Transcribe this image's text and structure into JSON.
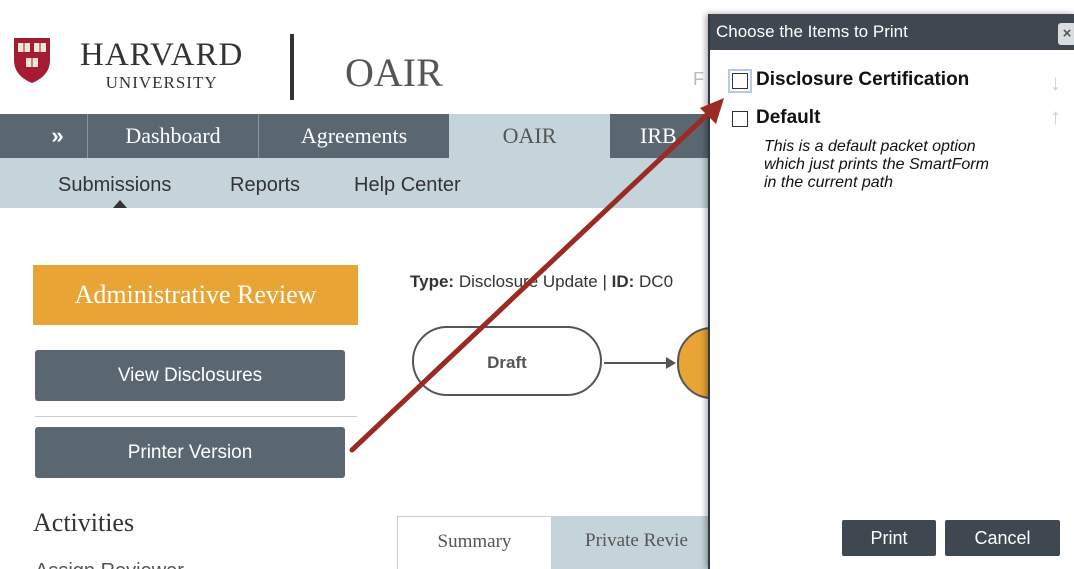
{
  "header": {
    "logo_line1": "HARVARD",
    "logo_line2": "UNIVERSITY",
    "site_title": "OAIR",
    "ghost_char": "F"
  },
  "nav": {
    "toggle": "»",
    "items": [
      {
        "label": "Dashboard"
      },
      {
        "label": "Agreements"
      },
      {
        "label": "OAIR"
      },
      {
        "label": "IRB"
      }
    ]
  },
  "subnav": {
    "items": [
      {
        "label": "Submissions"
      },
      {
        "label": "Reports"
      },
      {
        "label": "Help Center"
      }
    ]
  },
  "sidebar": {
    "state": "Administrative Review",
    "view_disclosures": "View Disclosures",
    "printer_version": "Printer Version",
    "activities_heading": "Activities",
    "activity_first": "Assign Reviewer"
  },
  "main": {
    "type_label": "Type:",
    "type_value": "Disclosure Update",
    "id_label": "ID:",
    "id_value": "DC0",
    "workflow": {
      "first_state": "Draft"
    },
    "tabs": [
      {
        "label": "Summary"
      },
      {
        "label": "Private Revie"
      }
    ]
  },
  "dialog": {
    "title": "Choose the Items to Print",
    "close_glyph": "×",
    "items": [
      {
        "label": "Disclosure Certification",
        "checked": false
      },
      {
        "label": "Default",
        "checked": false,
        "description": "This is a default packet option which just prints the SmartForm in the current path"
      }
    ],
    "move_down_glyph": "↓",
    "move_up_glyph": "↑",
    "print_button": "Print",
    "cancel_button": "Cancel"
  },
  "colors": {
    "nav_bg": "#5a6771",
    "subnav_bg": "#c5d3db",
    "state_badge": "#e8a535",
    "annotation_arrow": "#9a2a24",
    "dialog_titlebar": "#3f4850"
  }
}
